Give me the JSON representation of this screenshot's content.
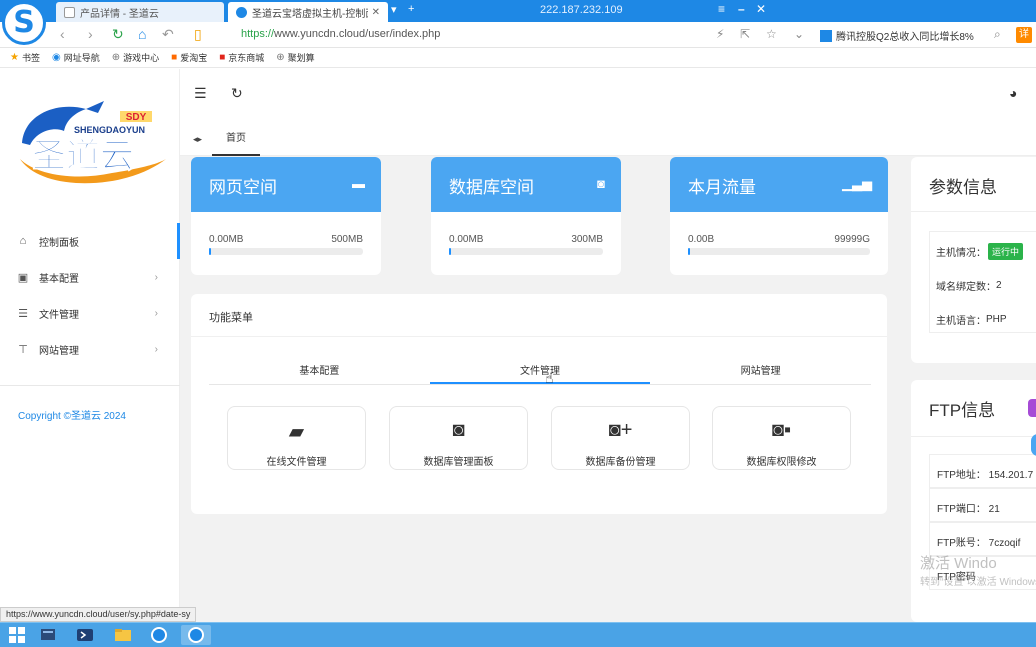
{
  "browser": {
    "tabs": [
      {
        "label": "产品详情 - 圣道云"
      },
      {
        "label": "圣道云宝塔虚拟主机-控制面板"
      }
    ],
    "ip": "222.187.232.109",
    "url_proto": "https://",
    "url_rest": "www.yuncdn.cloud/user/index.php",
    "news": "腾讯控股Q2总收入同比增长8%",
    "ext_label": "详",
    "bookmarks": [
      "书签",
      "网址导航",
      "游戏中心",
      "爱淘宝",
      "京东商城",
      "聚划算"
    ]
  },
  "sidebar": {
    "logo_brand": "SDY",
    "logo_en": "SHENGDAOYUN",
    "logo_cn": "圣道云",
    "items": [
      {
        "label": "控制面板",
        "icon": "home-icon"
      },
      {
        "label": "基本配置",
        "icon": "picture-icon"
      },
      {
        "label": "文件管理",
        "icon": "list-icon"
      },
      {
        "label": "网站管理",
        "icon": "sitemap-icon"
      }
    ],
    "copyright": "Copyright ©圣道云 2024"
  },
  "tabbar": {
    "home": "首页"
  },
  "stats": [
    {
      "title": "网页空间",
      "used": "0.00MB",
      "total": "500MB",
      "percent": 0,
      "icon": "server-icon"
    },
    {
      "title": "数据库空间",
      "used": "0.00MB",
      "total": "300MB",
      "percent": 0,
      "icon": "database-icon"
    },
    {
      "title": "本月流量",
      "used": "0.00B",
      "total": "99999G",
      "percent": 0,
      "icon": "signal-icon"
    }
  ],
  "functions": {
    "title": "功能菜单",
    "tabs": [
      "基本配置",
      "文件管理",
      "网站管理"
    ],
    "active_tab": "文件管理",
    "buttons": [
      {
        "label": "在线文件管理",
        "icon": "folder-open-icon"
      },
      {
        "label": "数据库管理面板",
        "icon": "database-icon"
      },
      {
        "label": "数据库备份管理",
        "icon": "database-plus-icon"
      },
      {
        "label": "数据库权限修改",
        "icon": "database-lock-icon"
      }
    ]
  },
  "params": {
    "title": "参数信息",
    "host_status_label": "主机情况：",
    "host_status": "运行中",
    "domain_count_label": "域名绑定数：",
    "domain_count": "2",
    "language_label": "主机语言：",
    "language": "PHP"
  },
  "ftp": {
    "title": "FTP信息",
    "address": "FTP地址： 154.201.7",
    "port": "FTP端口： 21",
    "account": "FTP账号： 7czoqif",
    "password": "FTP密码"
  },
  "watermark": {
    "line1": "激活 Windo",
    "line2": "转到“设置”以激活 Windows。"
  },
  "status_url": "https://www.yuncdn.cloud/user/sy.php#date-sy",
  "colors": {
    "accent": "#1e90ff",
    "card_head": "#4ba6f2",
    "running": "#2bb34a",
    "browser": "#1e88e5"
  }
}
